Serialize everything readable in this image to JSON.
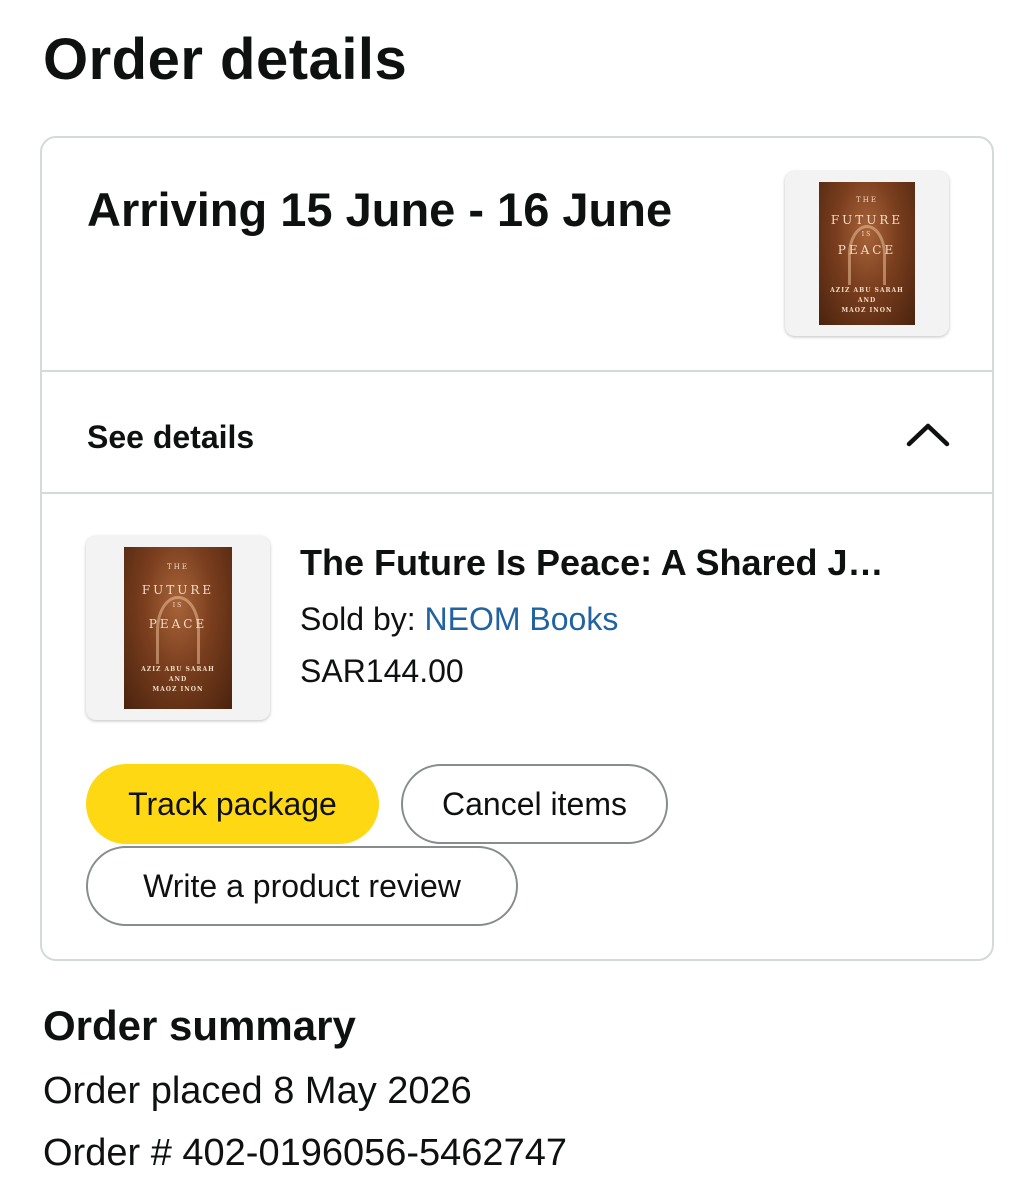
{
  "page": {
    "title": "Order details"
  },
  "shipment": {
    "arrival": "Arriving 15 June - 16 June",
    "see_details": "See details",
    "chevron_icon": "chevron-up-icon"
  },
  "item": {
    "title": "The Future Is Peace: A Shared J…",
    "sold_by_label": "Sold by:",
    "seller": "NEOM Books",
    "price": "SAR144.00",
    "cover": {
      "line1": "THE",
      "line2": "FUTURE",
      "line3": "IS",
      "line4": "PEACE",
      "line5": "AZIZ ABU SARAH",
      "line6": "AND",
      "line7": "MAOZ INON"
    }
  },
  "actions": {
    "track": "Track package",
    "cancel": "Cancel items",
    "review": "Write a product review"
  },
  "summary": {
    "title": "Order summary",
    "placed": "Order placed 8 May 2026",
    "number": "Order # 402-0196056-5462747"
  },
  "colors": {
    "accent_button": "#ffd814",
    "link": "#2162a1",
    "border": "#d5d9d9",
    "text": "#0f1111"
  }
}
